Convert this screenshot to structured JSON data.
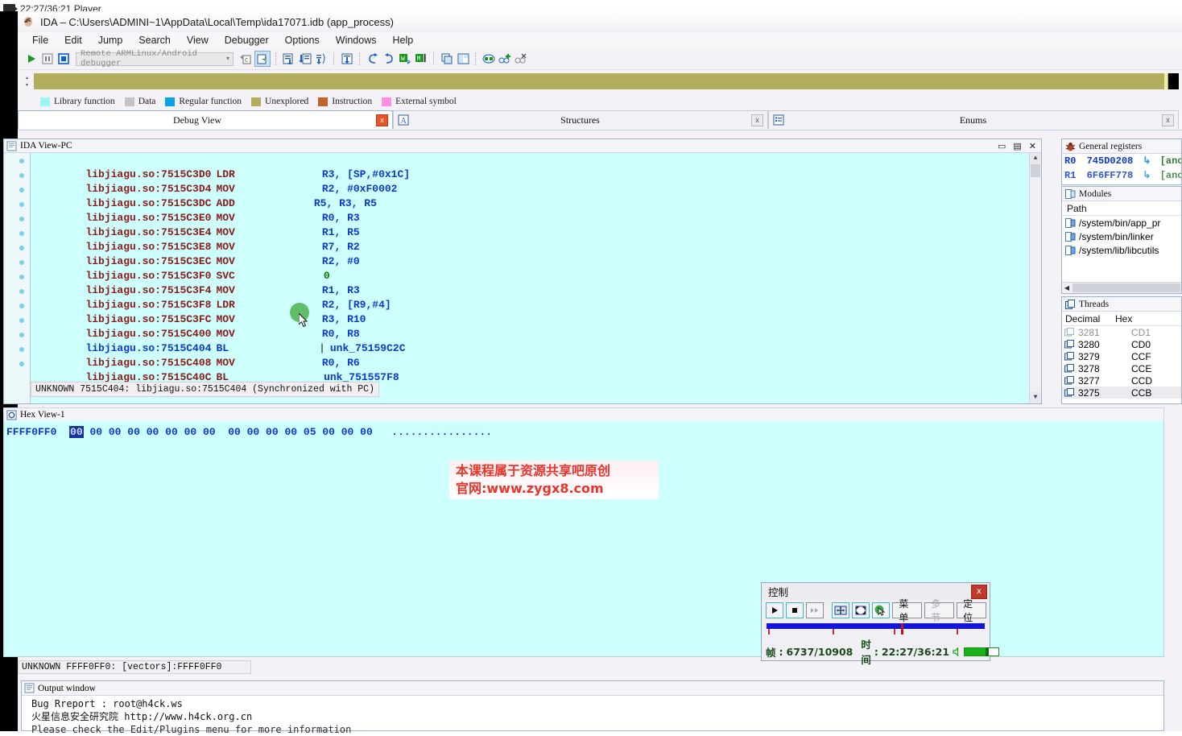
{
  "player": {
    "title": "22:27/36:21 Player",
    "icon": "video-camera-icon"
  },
  "ida": {
    "title": "IDA – C:\\Users\\ADMINI~1\\AppData\\Local\\Temp\\ida17071.idb (app_process)",
    "menus": [
      "File",
      "Edit",
      "Jump",
      "Search",
      "View",
      "Debugger",
      "Options",
      "Windows",
      "Help"
    ],
    "toolbar": {
      "debugger_select": "Remote ARMLinux/Android debugger",
      "caret": "▾"
    },
    "legend": [
      {
        "label": "Library function",
        "color": "#9ff5f1"
      },
      {
        "label": "Data",
        "color": "#c4c4c4"
      },
      {
        "label": "Regular function",
        "color": "#0aa2e8"
      },
      {
        "label": "Unexplored",
        "color": "#b3ae5e"
      },
      {
        "label": "Instruction",
        "color": "#c0622a"
      },
      {
        "label": "External symbol",
        "color": "#ff8fe0"
      }
    ],
    "navband_color": "#b3ae5e",
    "tabs": [
      {
        "label": "Debug View",
        "active": true,
        "close": "x"
      },
      {
        "label": "Structures",
        "active": false,
        "close": "x"
      },
      {
        "label": "Enums",
        "active": false,
        "close": "x"
      }
    ]
  },
  "idaview": {
    "title": "IDA View-PC",
    "window_buttons": [
      "▭",
      "▤",
      "✕"
    ],
    "status": "UNKNOWN 7515C404: libjiagu.so:7515C404 (Synchronized with PC)",
    "lines": [
      {
        "addr": "libjiagu.so:7515C3D0",
        "mnem": "LDR",
        "ops": "R3, [SP,#0x1C]",
        "call": false
      },
      {
        "addr": "libjiagu.so:7515C3D4",
        "mnem": "MOV",
        "ops": "R2, #0xF0002",
        "call": false
      },
      {
        "addr": "libjiagu.so:7515C3DC",
        "mnem": "ADD",
        "ops": "R5, R3, R5",
        "call": false
      },
      {
        "addr": "libjiagu.so:7515C3E0",
        "mnem": "MOV",
        "ops": "R0, R3",
        "call": false
      },
      {
        "addr": "libjiagu.so:7515C3E4",
        "mnem": "MOV",
        "ops": "R1, R5",
        "call": false
      },
      {
        "addr": "libjiagu.so:7515C3E8",
        "mnem": "MOV",
        "ops": "R7, R2",
        "call": false
      },
      {
        "addr": "libjiagu.so:7515C3EC",
        "mnem": "MOV",
        "ops": "R2, #0",
        "call": false
      },
      {
        "addr": "libjiagu.so:7515C3F0",
        "mnem": "SVC",
        "ops": "0",
        "call": false
      },
      {
        "addr": "libjiagu.so:7515C3F4",
        "mnem": "MOV",
        "ops": "R1, R3",
        "call": false
      },
      {
        "addr": "libjiagu.so:7515C3F8",
        "mnem": "LDR",
        "ops": "R2, [R9,#4]",
        "call": false
      },
      {
        "addr": "libjiagu.so:7515C3FC",
        "mnem": "MOV",
        "ops": "R3, R10",
        "call": false
      },
      {
        "addr": "libjiagu.so:7515C400",
        "mnem": "MOV",
        "ops": "R0, R8",
        "call": false
      },
      {
        "addr": "libjiagu.so:7515C404",
        "mnem": "BL",
        "ops": "unk_75159C2C",
        "call": true
      },
      {
        "addr": "libjiagu.so:7515C408",
        "mnem": "MOV",
        "ops": "R0, R6",
        "call": false
      },
      {
        "addr": "libjiagu.so:7515C40C",
        "mnem": "BL",
        "ops": "unk_751557F8",
        "call": false
      }
    ]
  },
  "registers": {
    "title": "General registers",
    "rows": [
      {
        "name": "R0",
        "value": "745D0208",
        "comment": "[ano"
      },
      {
        "name": "R1",
        "value": "6F6FF778",
        "comment": "[ano"
      }
    ]
  },
  "modules": {
    "title": "Modules",
    "column": "Path",
    "rows": [
      "/system/bin/app_pr",
      "/system/bin/linker",
      "/system/lib/libcutils"
    ]
  },
  "threads": {
    "title": "Threads",
    "columns": [
      "Decimal",
      "Hex"
    ],
    "rows": [
      {
        "decimal": "3281",
        "hex": "CD1"
      },
      {
        "decimal": "3280",
        "hex": "CD0"
      },
      {
        "decimal": "3279",
        "hex": "CCF"
      },
      {
        "decimal": "3278",
        "hex": "CCE"
      },
      {
        "decimal": "3277",
        "hex": "CCD"
      },
      {
        "decimal": "3275",
        "hex": "CCB"
      }
    ]
  },
  "hexview": {
    "title": "Hex View-1",
    "address": "FFFF0FF0",
    "selected_byte": "00",
    "bytes_left": [
      "00",
      "00",
      "00",
      "00",
      "00",
      "00",
      "00"
    ],
    "bytes_right": [
      "00",
      "00",
      "00",
      "00",
      "05",
      "00",
      "00",
      "00"
    ],
    "ascii": "................"
  },
  "watermark": {
    "line1": "本课程属于资源共享吧原创",
    "line2": "官网:www.zygx8.com"
  },
  "control": {
    "title": "控制",
    "close": "x",
    "buttons": [
      {
        "name": "play",
        "glyph": "▶",
        "disabled": false,
        "selected": true
      },
      {
        "name": "stop",
        "glyph": "■",
        "disabled": false,
        "selected": true
      },
      {
        "name": "step",
        "glyph": "⏭",
        "disabled": true,
        "selected": false
      },
      {
        "name": "fit-window",
        "glyph": "⛶",
        "disabled": false,
        "selected": true
      },
      {
        "name": "fullscreen",
        "glyph": "⬚",
        "disabled": false,
        "selected": true
      },
      {
        "name": "pointer",
        "glyph": "●",
        "disabled": false,
        "selected": true
      }
    ],
    "text_buttons": [
      {
        "name": "menu",
        "label": "菜单",
        "disabled": false
      },
      {
        "name": "multi-section",
        "label": "多节",
        "disabled": true
      },
      {
        "name": "locate",
        "label": "定位",
        "disabled": false
      }
    ],
    "frame_label": "帧",
    "frame_value": "6737/10908",
    "time_label": "时间",
    "time_value": "22:27/36:21",
    "progress_percent": 61.8
  },
  "bottom_status": "UNKNOWN FFFF0FF0: [vectors]:FFFF0FF0",
  "output": {
    "title": "Output window",
    "lines": [
      "Bug Rreport : root@h4ck.ws",
      "火星信息安全研究院 http://www.h4ck.org.cn",
      "Please check the Edit/Plugins menu for more information"
    ]
  }
}
